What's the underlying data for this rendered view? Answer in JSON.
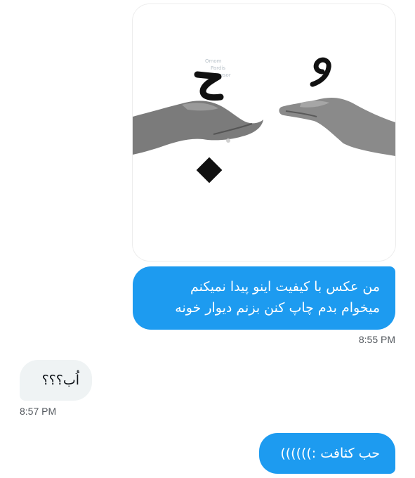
{
  "messages": [
    {
      "type": "image",
      "direction": "outgoing",
      "image": {
        "watermark": "Omom Pardis Tensor",
        "top_glyph": "ُ",
        "middle_glyph": "ح",
        "bottom_glyph": "ب"
      }
    },
    {
      "type": "text",
      "direction": "outgoing",
      "lines": [
        "من عکس با کیفیت اینو پیدا نمیکنم",
        "میخوام بدم چاپ کنن بزنم دیوار خونه"
      ],
      "time": "8:55 PM"
    },
    {
      "type": "text",
      "direction": "incoming",
      "text": "اُب؟؟؟",
      "time": "8:57 PM"
    },
    {
      "type": "text",
      "direction": "outgoing",
      "text": "حب کثافت :))))))"
    }
  ],
  "colors": {
    "outgoing_bubble": "#1d9bf0",
    "incoming_bubble": "#eff3f4",
    "timestamp": "#53585e"
  }
}
